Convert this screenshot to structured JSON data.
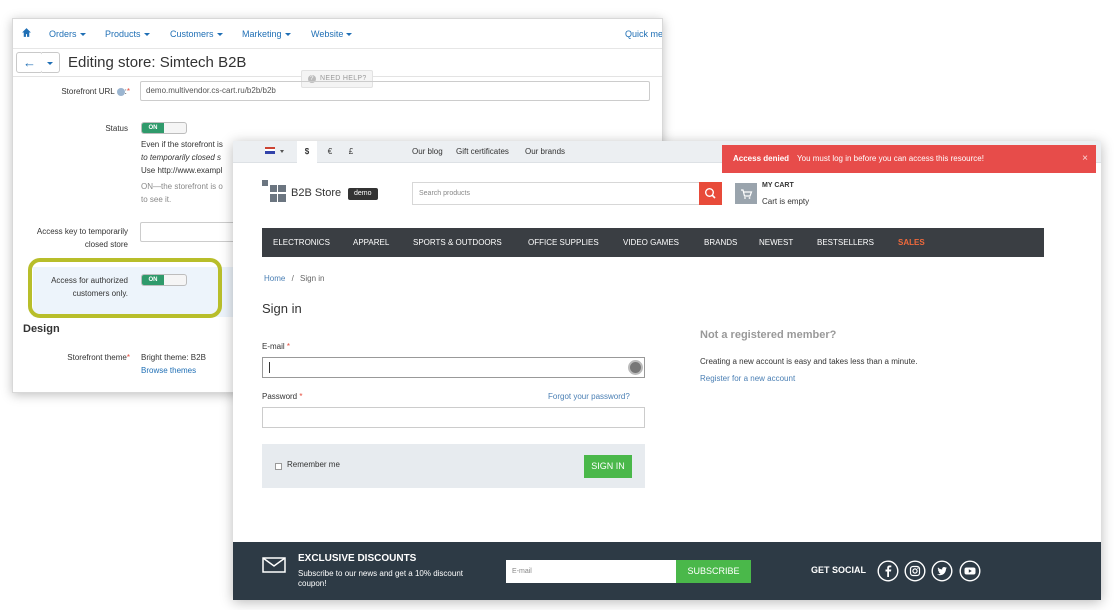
{
  "admin": {
    "topnav": [
      "Orders",
      "Products",
      "Customers",
      "Marketing",
      "Website"
    ],
    "quick_menu": "Quick me",
    "title": "Editing store: Simtech B2B",
    "need_help": "NEED HELP?",
    "storefront_url_label": "Storefront URL",
    "storefront_url_value": "demo.multivendor.cs-cart.ru/b2b/b2b",
    "status_label": "Status",
    "toggle_on": "ON",
    "status_desc_1": "Even if the storefront is",
    "status_desc_2": "to temporarily closed s",
    "status_desc_3": "Use http://www.exampl",
    "status_desc_4": "ON—the storefront is o",
    "status_desc_5": "to see it.",
    "access_key_label_1": "Access key to temporarily",
    "access_key_label_2": "closed store",
    "authorized_label_1": "Access for authorized",
    "authorized_label_2": "customers only.",
    "design_heading": "Design",
    "theme_label": "Storefront theme",
    "theme_value": "Bright theme: B2B",
    "browse_themes": "Browse themes"
  },
  "store": {
    "currencies": [
      "$",
      "€",
      "£"
    ],
    "top_links": [
      "Our blog",
      "Gift certificates",
      "Our brands"
    ],
    "alert_title": "Access denied",
    "alert_message": "You must log in before you can access this resource!",
    "alert_close": "×",
    "logo_text": "B2B Store",
    "demo_badge": "demo",
    "search_placeholder": "Search products",
    "cart_title": "MY CART",
    "cart_status": "Cart is empty",
    "nav": [
      "ELECTRONICS",
      "APPAREL",
      "SPORTS & OUTDOORS",
      "OFFICE SUPPLIES",
      "VIDEO GAMES",
      "BRANDS",
      "NEWEST",
      "BESTSELLERS",
      "SALES"
    ],
    "breadcrumb_home": "Home",
    "breadcrumb_sep": "/",
    "breadcrumb_current": "Sign in",
    "heading": "Sign in",
    "email_label": "E-mail",
    "password_label": "Password",
    "forgot_password": "Forgot your password?",
    "remember_me": "Remember me",
    "sign_in_button": "SIGN IN",
    "not_registered_title": "Not a registered member?",
    "not_registered_text": "Creating a new account is easy and takes less than a minute.",
    "register_link": "Register for a new account",
    "footer": {
      "discount_title": "EXCLUSIVE DISCOUNTS",
      "discount_text": "Subscribe to our news and get a 10% discount coupon!",
      "email_placeholder": "E-mail",
      "subscribe_button": "SUBSCRIBE",
      "get_social": "GET SOCIAL"
    }
  },
  "colors": {
    "alert_red": "#e74c4a",
    "green_button": "#4ab84a",
    "nav_dark": "#3a3e43",
    "footer_dark": "#2d3a45",
    "toggle_green": "#2f9a6b",
    "highlight_ring": "#b8be2a",
    "admin_link_blue": "#1f6fb5"
  },
  "icons": {
    "social": [
      "facebook-icon",
      "instagram-icon",
      "twitter-icon",
      "youtube-icon"
    ]
  }
}
